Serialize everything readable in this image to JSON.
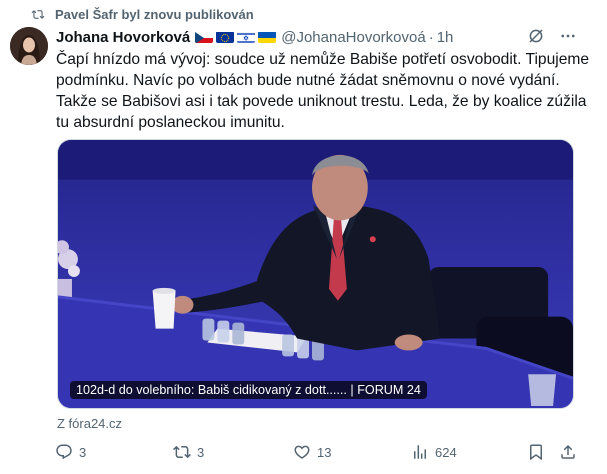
{
  "repost": {
    "text": "Pavel Šafr byl znovu publikován",
    "icon": "repost-icon"
  },
  "author": {
    "name": "Johana Hovorková",
    "flags": [
      "czech-flag",
      "eu-flag",
      "israel-flag",
      "ukraine-flag"
    ],
    "handle": "@JohanaHovorkovoá",
    "separator": "·",
    "time": "1h"
  },
  "tweet": {
    "text": "Čapí hnízdo má vývoj: soudce už nemůže Babiše potřetí osvobodit. Tipujeme podmínku. Navíc po volbách bude nutné žádat sněmovnu o nové vydání. Takže se Babišovi asi i tak povede uniknout trestu. Leda, že by koalice zúžila tu absurdní poslaneckou imunitu."
  },
  "card": {
    "caption": "102d-d do volebního: Babiš cidikovaný z dott...... | FORUM 24",
    "source": "Z fóra24.cz"
  },
  "actions": {
    "reply_count": "3",
    "repost_count": "3",
    "like_count": "13",
    "views_count": "624"
  },
  "colors": {
    "text": "#0f1419",
    "secondary": "#536471",
    "stage_blue": "#2c2c9a"
  }
}
